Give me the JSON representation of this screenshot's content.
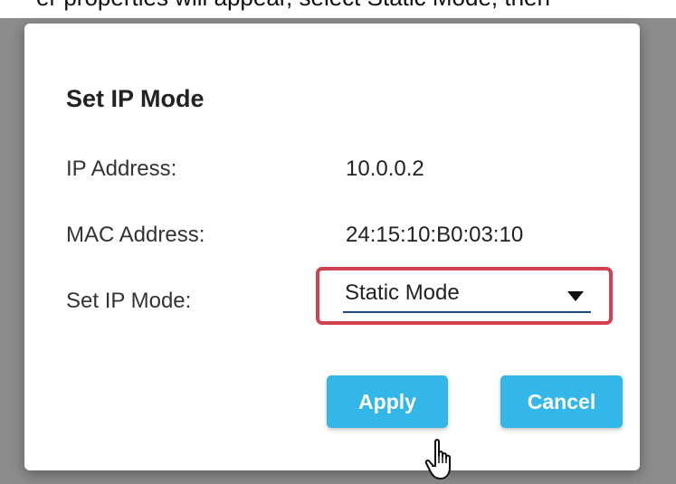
{
  "header_fragment": "er properties will appear, select Static Mode, then",
  "dialog": {
    "title": "Set IP Mode",
    "rows": [
      {
        "label": "IP Address:",
        "value": "10.0.0.2"
      },
      {
        "label": "MAC Address:",
        "value": "24:15:10:B0:03:10"
      }
    ],
    "mode_label": "Set IP Mode:",
    "mode_selected": "Static Mode",
    "apply_label": "Apply",
    "cancel_label": "Cancel"
  },
  "colors": {
    "button": "#33b6e8",
    "highlight": "#d2414f",
    "underline": "#1c4a78"
  },
  "icons": {
    "dropdown": "caret-down-icon",
    "cursor": "hand-pointer-icon"
  }
}
